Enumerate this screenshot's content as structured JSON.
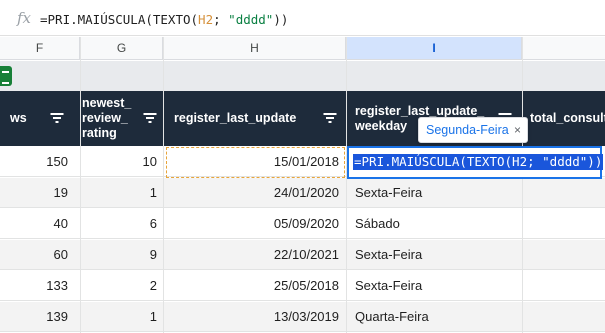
{
  "formula_bar": {
    "fx_label": "fx",
    "formula_prefix": "=PRI.MAIÚSCULA(TEXTO(",
    "formula_ref": "H2",
    "formula_sep": "; ",
    "formula_str": "\"dddd\"",
    "formula_suffix": "))"
  },
  "columns": [
    "F",
    "G",
    "H",
    "I"
  ],
  "headers": {
    "f": "ws",
    "g": "newest_ review_ rating",
    "h": "register_last_update",
    "i": "register_last_update_ weekday",
    "j": "total_consult"
  },
  "tooltip": {
    "text": "Segunda-Feira",
    "close": "×"
  },
  "editing": {
    "text": "=PRI.MAIÚSCULA(TEXTO(H2; \"dddd\"))"
  },
  "rows": [
    {
      "f": "150",
      "g": "10",
      "h": "15/01/2018",
      "i": ""
    },
    {
      "f": "19",
      "g": "1",
      "h": "24/01/2020",
      "i": "Sexta-Feira"
    },
    {
      "f": "40",
      "g": "6",
      "h": "05/09/2020",
      "i": "Sábado"
    },
    {
      "f": "60",
      "g": "9",
      "h": "22/10/2021",
      "i": "Sexta-Feira"
    },
    {
      "f": "133",
      "g": "2",
      "h": "25/05/2018",
      "i": "Sexta-Feira"
    },
    {
      "f": "139",
      "g": "1",
      "h": "13/03/2019",
      "i": "Quarta-Feira"
    }
  ],
  "colors": {
    "header_bg": "#1e2b3b",
    "selection": "#1a73e8",
    "copy_border": "#e8a53a"
  }
}
